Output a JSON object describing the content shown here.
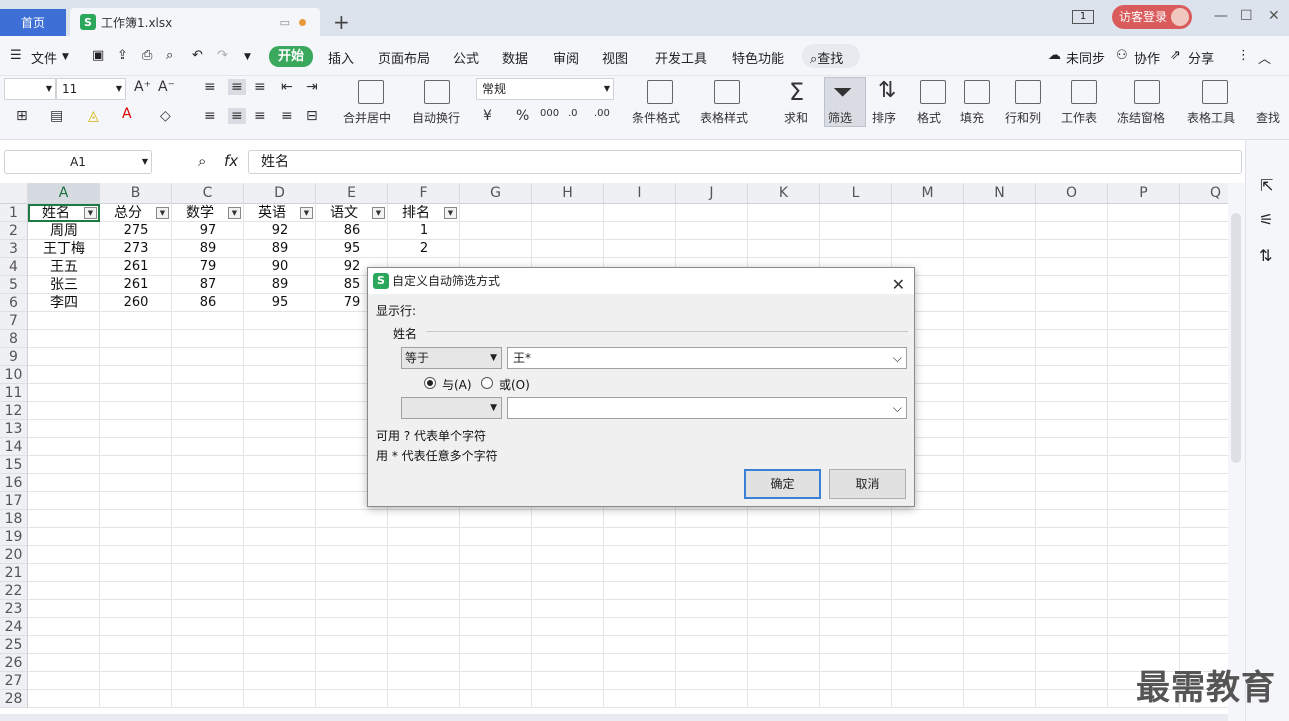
{
  "tabs": {
    "home": "首页",
    "file": "工作簿1.xlsx",
    "file_icon": "S"
  },
  "window": {
    "login": "访客登录",
    "page_badge": "1"
  },
  "menu": {
    "file": "文件",
    "items": [
      "开始",
      "插入",
      "页面布局",
      "公式",
      "数据",
      "审阅",
      "视图",
      "开发工具",
      "特色功能"
    ],
    "search": "查找",
    "sync": "未同步",
    "collab": "协作",
    "share": "分享"
  },
  "toolbar": {
    "font_size": "11",
    "number_format": "常规",
    "labels": [
      "合并居中",
      "自动换行",
      "条件格式",
      "表格样式",
      "求和",
      "筛选",
      "排序",
      "格式",
      "填充",
      "行和列",
      "工作表",
      "冻结窗格",
      "表格工具",
      "查找"
    ]
  },
  "formula_bar": {
    "name_box": "A1",
    "fx": "fx",
    "content": "姓名"
  },
  "sheet": {
    "columns": [
      "A",
      "B",
      "C",
      "D",
      "E",
      "F",
      "G",
      "H",
      "I",
      "J",
      "K",
      "L",
      "M",
      "N",
      "O",
      "P",
      "Q"
    ],
    "rows": [
      "1",
      "2",
      "3",
      "4",
      "5",
      "6",
      "7",
      "8",
      "9",
      "10",
      "11",
      "12",
      "13",
      "14",
      "15",
      "16",
      "17",
      "18",
      "19",
      "20",
      "21",
      "22",
      "23",
      "24",
      "25",
      "26",
      "27",
      "28"
    ],
    "headers": [
      "姓名",
      "总分",
      "数学",
      "英语",
      "语文",
      "排名"
    ],
    "data": [
      [
        "周周",
        "275",
        "97",
        "92",
        "86",
        "1"
      ],
      [
        "王丁梅",
        "273",
        "89",
        "89",
        "95",
        "2"
      ],
      [
        "王五",
        "261",
        "79",
        "90",
        "92",
        ""
      ],
      [
        "张三",
        "261",
        "87",
        "89",
        "85",
        ""
      ],
      [
        "李四",
        "260",
        "86",
        "95",
        "79",
        ""
      ]
    ]
  },
  "dialog": {
    "title": "自定义自动筛选方式",
    "show_rows": "显示行:",
    "field": "姓名",
    "op1": "等于",
    "val1": "王*",
    "and_label": "与(A)",
    "or_label": "或(O)",
    "op2": "",
    "val2": "",
    "hint1": "可用 ? 代表单个字符",
    "hint2": "用 * 代表任意多个字符",
    "ok": "确定",
    "cancel": "取消"
  },
  "watermark": "最需教育"
}
